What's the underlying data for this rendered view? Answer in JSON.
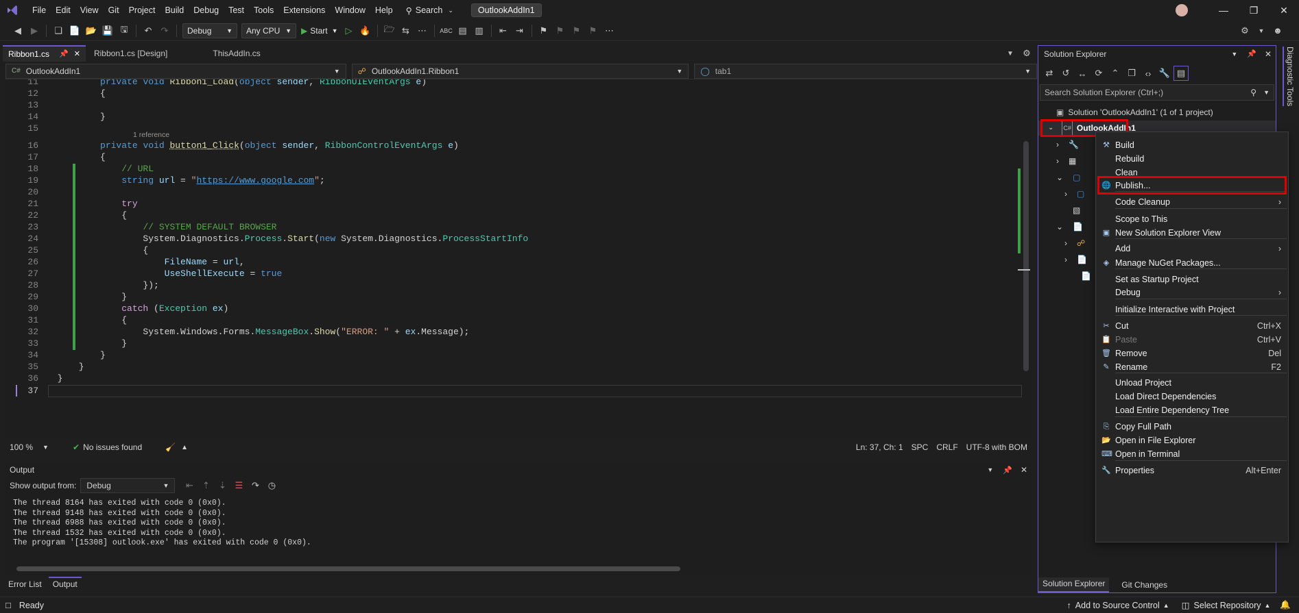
{
  "menubar": {
    "items": [
      "File",
      "Edit",
      "View",
      "Git",
      "Project",
      "Build",
      "Debug",
      "Test",
      "Tools",
      "Extensions",
      "Window",
      "Help"
    ],
    "search_label": "Search",
    "project_title": "OutlookAddIn1"
  },
  "toolbar": {
    "config": "Debug",
    "platform": "Any CPU",
    "start_label": "Start"
  },
  "tabs": [
    {
      "label": "Ribbon1.cs",
      "active": true
    },
    {
      "label": "Ribbon1.cs [Design]",
      "active": false
    },
    {
      "label": "ThisAddIn.cs",
      "active": false
    }
  ],
  "navbar": {
    "project": "OutlookAddIn1",
    "class": "OutlookAddIn1.Ribbon1",
    "member": "tab1"
  },
  "editor": {
    "codelens": "1 reference",
    "link_url": "https://www.google.com"
  },
  "editor_status": {
    "zoom": "100 %",
    "issues": "No issues found",
    "position": "Ln: 37, Ch: 1",
    "whitespace": "SPC",
    "line_ending": "CRLF",
    "encoding": "UTF-8 with BOM"
  },
  "output": {
    "title": "Output",
    "show_from_label": "Show output from:",
    "source": "Debug",
    "lines": [
      "The thread 8164 has exited with code 0 (0x0).",
      "The thread 9148 has exited with code 0 (0x0).",
      "The thread 6988 has exited with code 0 (0x0).",
      "The thread 1532 has exited with code 0 (0x0).",
      "The program '[15308] outlook.exe' has exited with code 0 (0x0)."
    ]
  },
  "bottom_tabs": [
    "Error List",
    "Output"
  ],
  "statusbar": {
    "ready": "Ready",
    "source_control": "Add to Source Control",
    "repository": "Select Repository"
  },
  "solution_explorer": {
    "title": "Solution Explorer",
    "search_placeholder": "Search Solution Explorer (Ctrl+;)",
    "solution": "Solution 'OutlookAddIn1' (1 of 1 project)",
    "project": "OutlookAddIn1",
    "bottom_tabs": [
      "Solution Explorer",
      "Git Changes"
    ],
    "side_tab": "Diagnostic Tools"
  },
  "context_menu": {
    "items": [
      {
        "label": "Build",
        "icon": "build-icon",
        "shortcut": ""
      },
      {
        "label": "Rebuild",
        "icon": "",
        "shortcut": ""
      },
      {
        "label": "Clean",
        "icon": "",
        "shortcut": ""
      },
      {
        "label": "Publish...",
        "icon": "globe-icon",
        "shortcut": "",
        "highlighted": true
      },
      {
        "label": "Code Cleanup",
        "icon": "",
        "submenu": true
      },
      {
        "label": "Scope to This",
        "icon": "",
        "shortcut": ""
      },
      {
        "label": "New Solution Explorer View",
        "icon": "new-view-icon",
        "shortcut": ""
      },
      {
        "label": "Add",
        "icon": "",
        "submenu": true
      },
      {
        "label": "Manage NuGet Packages...",
        "icon": "nuget-icon",
        "shortcut": ""
      },
      {
        "label": "Set as Startup Project",
        "icon": "",
        "shortcut": ""
      },
      {
        "label": "Debug",
        "icon": "",
        "submenu": true
      },
      {
        "label": "Initialize Interactive with Project",
        "icon": "",
        "shortcut": ""
      },
      {
        "label": "Cut",
        "icon": "cut-icon",
        "shortcut": "Ctrl+X"
      },
      {
        "label": "Paste",
        "icon": "paste-icon",
        "shortcut": "Ctrl+V",
        "disabled": true
      },
      {
        "label": "Remove",
        "icon": "remove-icon",
        "shortcut": "Del"
      },
      {
        "label": "Rename",
        "icon": "rename-icon",
        "shortcut": "F2"
      },
      {
        "label": "Unload Project",
        "icon": "",
        "shortcut": ""
      },
      {
        "label": "Load Direct Dependencies",
        "icon": "",
        "shortcut": ""
      },
      {
        "label": "Load Entire Dependency Tree",
        "icon": "",
        "shortcut": ""
      },
      {
        "label": "Copy Full Path",
        "icon": "copy-icon",
        "shortcut": ""
      },
      {
        "label": "Open in File Explorer",
        "icon": "folder-icon",
        "shortcut": ""
      },
      {
        "label": "Open in Terminal",
        "icon": "terminal-icon",
        "shortcut": ""
      },
      {
        "label": "Properties",
        "icon": "wrench-icon",
        "shortcut": "Alt+Enter"
      }
    ]
  },
  "colors": {
    "accent": "#6a5acd",
    "highlight_box": "#e00000",
    "change_bar": "#3fa04a"
  }
}
